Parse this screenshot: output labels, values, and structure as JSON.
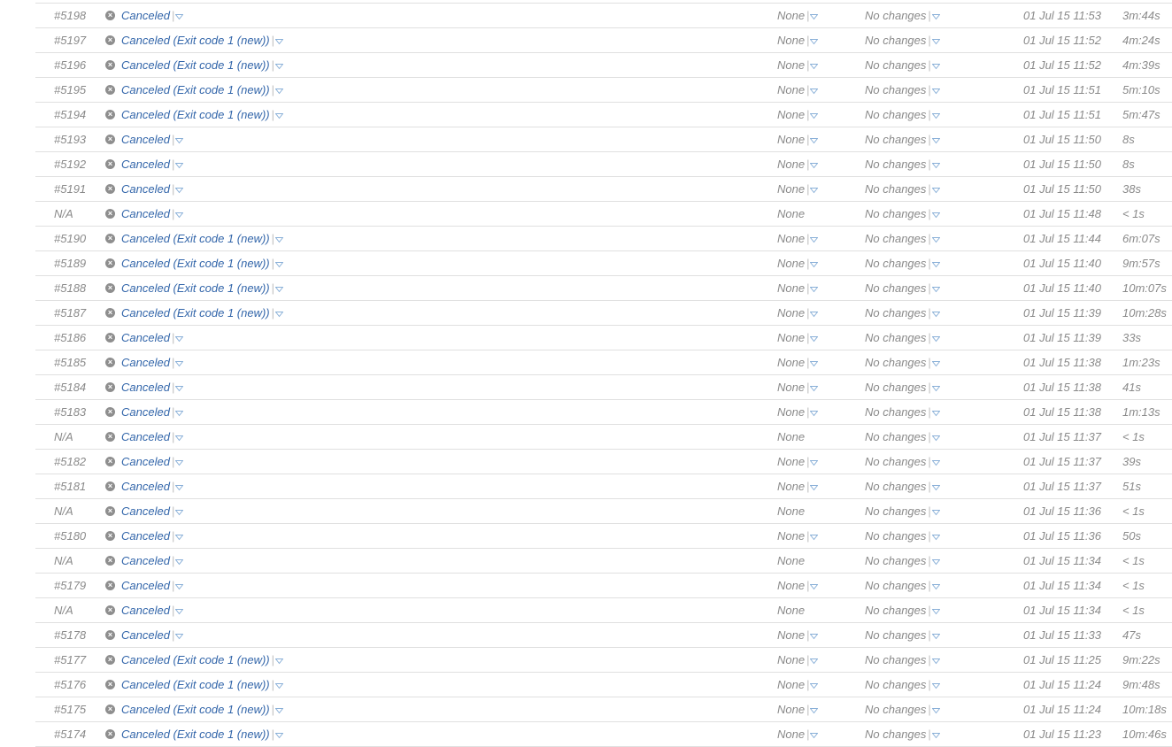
{
  "icons": {
    "status": "canceled-icon",
    "dropdown": "dropdown-arrow-icon"
  },
  "colors": {
    "link": "#3366aa",
    "text": "#8a8a8a",
    "divider": "#e0e0e0",
    "status_icon": "#8e8e8e"
  },
  "rows": [
    {
      "number": "#5198",
      "status": "Canceled",
      "agent": "None",
      "agent_menu": true,
      "changes": "No changes",
      "date": "01 Jul 15 11:53",
      "duration": "3m:44s"
    },
    {
      "number": "#5197",
      "status": "Canceled (Exit code 1 (new))",
      "agent": "None",
      "agent_menu": true,
      "changes": "No changes",
      "date": "01 Jul 15 11:52",
      "duration": "4m:24s"
    },
    {
      "number": "#5196",
      "status": "Canceled (Exit code 1 (new))",
      "agent": "None",
      "agent_menu": true,
      "changes": "No changes",
      "date": "01 Jul 15 11:52",
      "duration": "4m:39s"
    },
    {
      "number": "#5195",
      "status": "Canceled (Exit code 1 (new))",
      "agent": "None",
      "agent_menu": true,
      "changes": "No changes",
      "date": "01 Jul 15 11:51",
      "duration": "5m:10s"
    },
    {
      "number": "#5194",
      "status": "Canceled (Exit code 1 (new))",
      "agent": "None",
      "agent_menu": true,
      "changes": "No changes",
      "date": "01 Jul 15 11:51",
      "duration": "5m:47s"
    },
    {
      "number": "#5193",
      "status": "Canceled",
      "agent": "None",
      "agent_menu": true,
      "changes": "No changes",
      "date": "01 Jul 15 11:50",
      "duration": "8s"
    },
    {
      "number": "#5192",
      "status": "Canceled",
      "agent": "None",
      "agent_menu": true,
      "changes": "No changes",
      "date": "01 Jul 15 11:50",
      "duration": "8s"
    },
    {
      "number": "#5191",
      "status": "Canceled",
      "agent": "None",
      "agent_menu": true,
      "changes": "No changes",
      "date": "01 Jul 15 11:50",
      "duration": "38s"
    },
    {
      "number": "N/A",
      "status": "Canceled",
      "agent": "None",
      "agent_menu": false,
      "changes": "No changes",
      "date": "01 Jul 15 11:48",
      "duration": "< 1s"
    },
    {
      "number": "#5190",
      "status": "Canceled (Exit code 1 (new))",
      "agent": "None",
      "agent_menu": true,
      "changes": "No changes",
      "date": "01 Jul 15 11:44",
      "duration": "6m:07s"
    },
    {
      "number": "#5189",
      "status": "Canceled (Exit code 1 (new))",
      "agent": "None",
      "agent_menu": true,
      "changes": "No changes",
      "date": "01 Jul 15 11:40",
      "duration": "9m:57s"
    },
    {
      "number": "#5188",
      "status": "Canceled (Exit code 1 (new))",
      "agent": "None",
      "agent_menu": true,
      "changes": "No changes",
      "date": "01 Jul 15 11:40",
      "duration": "10m:07s"
    },
    {
      "number": "#5187",
      "status": "Canceled (Exit code 1 (new))",
      "agent": "None",
      "agent_menu": true,
      "changes": "No changes",
      "date": "01 Jul 15 11:39",
      "duration": "10m:28s"
    },
    {
      "number": "#5186",
      "status": "Canceled",
      "agent": "None",
      "agent_menu": true,
      "changes": "No changes",
      "date": "01 Jul 15 11:39",
      "duration": "33s"
    },
    {
      "number": "#5185",
      "status": "Canceled",
      "agent": "None",
      "agent_menu": true,
      "changes": "No changes",
      "date": "01 Jul 15 11:38",
      "duration": "1m:23s"
    },
    {
      "number": "#5184",
      "status": "Canceled",
      "agent": "None",
      "agent_menu": true,
      "changes": "No changes",
      "date": "01 Jul 15 11:38",
      "duration": "41s"
    },
    {
      "number": "#5183",
      "status": "Canceled",
      "agent": "None",
      "agent_menu": true,
      "changes": "No changes",
      "date": "01 Jul 15 11:38",
      "duration": "1m:13s"
    },
    {
      "number": "N/A",
      "status": "Canceled",
      "agent": "None",
      "agent_menu": false,
      "changes": "No changes",
      "date": "01 Jul 15 11:37",
      "duration": "< 1s"
    },
    {
      "number": "#5182",
      "status": "Canceled",
      "agent": "None",
      "agent_menu": true,
      "changes": "No changes",
      "date": "01 Jul 15 11:37",
      "duration": "39s"
    },
    {
      "number": "#5181",
      "status": "Canceled",
      "agent": "None",
      "agent_menu": true,
      "changes": "No changes",
      "date": "01 Jul 15 11:37",
      "duration": "51s"
    },
    {
      "number": "N/A",
      "status": "Canceled",
      "agent": "None",
      "agent_menu": false,
      "changes": "No changes",
      "date": "01 Jul 15 11:36",
      "duration": "< 1s"
    },
    {
      "number": "#5180",
      "status": "Canceled",
      "agent": "None",
      "agent_menu": true,
      "changes": "No changes",
      "date": "01 Jul 15 11:36",
      "duration": "50s"
    },
    {
      "number": "N/A",
      "status": "Canceled",
      "agent": "None",
      "agent_menu": false,
      "changes": "No changes",
      "date": "01 Jul 15 11:34",
      "duration": "< 1s"
    },
    {
      "number": "#5179",
      "status": "Canceled",
      "agent": "None",
      "agent_menu": true,
      "changes": "No changes",
      "date": "01 Jul 15 11:34",
      "duration": "< 1s"
    },
    {
      "number": "N/A",
      "status": "Canceled",
      "agent": "None",
      "agent_menu": false,
      "changes": "No changes",
      "date": "01 Jul 15 11:34",
      "duration": "< 1s"
    },
    {
      "number": "#5178",
      "status": "Canceled",
      "agent": "None",
      "agent_menu": true,
      "changes": "No changes",
      "date": "01 Jul 15 11:33",
      "duration": "47s"
    },
    {
      "number": "#5177",
      "status": "Canceled (Exit code 1 (new))",
      "agent": "None",
      "agent_menu": true,
      "changes": "No changes",
      "date": "01 Jul 15 11:25",
      "duration": "9m:22s"
    },
    {
      "number": "#5176",
      "status": "Canceled (Exit code 1 (new))",
      "agent": "None",
      "agent_menu": true,
      "changes": "No changes",
      "date": "01 Jul 15 11:24",
      "duration": "9m:48s"
    },
    {
      "number": "#5175",
      "status": "Canceled (Exit code 1 (new))",
      "agent": "None",
      "agent_menu": true,
      "changes": "No changes",
      "date": "01 Jul 15 11:24",
      "duration": "10m:18s"
    },
    {
      "number": "#5174",
      "status": "Canceled (Exit code 1 (new))",
      "agent": "None",
      "agent_menu": true,
      "changes": "No changes",
      "date": "01 Jul 15 11:23",
      "duration": "10m:46s"
    }
  ]
}
